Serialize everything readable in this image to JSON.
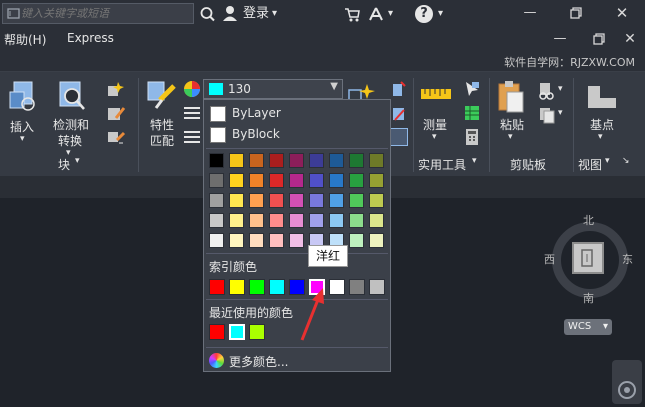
{
  "titlebar": {
    "search_placeholder": "键入关键字或短语",
    "login_label": "登录",
    "help_icon_label": "?"
  },
  "menubar": {
    "items": [
      "帮助(H)",
      "Express"
    ]
  },
  "tabstrip": {
    "watermark": "软件自学网：RJZXW.COM"
  },
  "ribbon": {
    "insert_label": "插入",
    "detect_label_1": "检测和",
    "detect_label_2": "转换",
    "block_group": "块",
    "props_label_1": "特性",
    "props_label_2": "匹配",
    "measure_label": "测量",
    "tools_group": "实用工具",
    "paste_label": "粘贴",
    "clipboard_group": "剪贴板",
    "base_label": "基点",
    "view_group": "视图"
  },
  "color_combo": {
    "value": "130",
    "swatch_color": "#00ffff"
  },
  "dropdown": {
    "bylayer": "ByLayer",
    "byblock": "ByBlock",
    "index_title": "索引颜色",
    "recent_title": "最近使用的颜色",
    "more_label": "更多颜色...",
    "grid": [
      [
        "#000000",
        "#f5c518",
        "#c8641e",
        "#aa1e1e",
        "#8c1e5a",
        "#3c3c96",
        "#1e5a96",
        "#1e7832",
        "#6e7a28"
      ],
      [
        "#6e6e6e",
        "#ffd21e",
        "#f08228",
        "#dc2828",
        "#b4288c",
        "#5050c8",
        "#2878c8",
        "#28a040",
        "#96a032"
      ],
      [
        "#a0a0a0",
        "#ffe650",
        "#ffa050",
        "#f05050",
        "#d250b4",
        "#7878dc",
        "#50a0e6",
        "#50c85a",
        "#beca50"
      ],
      [
        "#c8c8c8",
        "#fff08c",
        "#ffc08c",
        "#ff8c8c",
        "#e68cd2",
        "#a0a0ec",
        "#8cc8f2",
        "#8cdc8c",
        "#dce68c"
      ],
      [
        "#f0f0f0",
        "#fff5be",
        "#ffdcbe",
        "#ffbebe",
        "#f0bee6",
        "#c8c8f5",
        "#bee0fa",
        "#bef0be",
        "#eef2be"
      ]
    ],
    "index_colors": [
      "#ff0000",
      "#ffff00",
      "#00ff00",
      "#00ffff",
      "#0000ff",
      "#ff00ff",
      "#ffffff",
      "#808080",
      "#c0c0c0"
    ],
    "recent_colors": [
      "#ff0000",
      "#00ffff",
      "#aaff00"
    ]
  },
  "tooltip": {
    "text": "洋红"
  },
  "viewcube": {
    "north": "北",
    "south": "南",
    "east": "东",
    "west": "西",
    "wcs": "WCS"
  },
  "colors": {
    "accent_red": "#e83030",
    "selected_index": "#ff00ff"
  }
}
